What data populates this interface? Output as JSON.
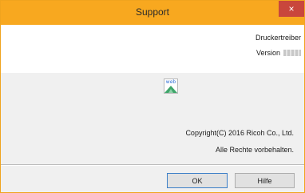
{
  "window": {
    "title": "Support",
    "close_glyph": "×"
  },
  "header": {
    "product": "Druckertreiber",
    "version_label": "Version"
  },
  "web_icon": {
    "label": "web",
    "icon": "web-link-icon"
  },
  "footer": {
    "copyright": "Copyright(C) 2016 Ricoh Co., Ltd.",
    "rights": "Alle Rechte vorbehalten."
  },
  "buttons": {
    "ok": "OK",
    "help": "Hilfe"
  },
  "colors": {
    "titlebar": "#f8a81f",
    "close": "#c9463c",
    "link": "#2f6fd6"
  }
}
